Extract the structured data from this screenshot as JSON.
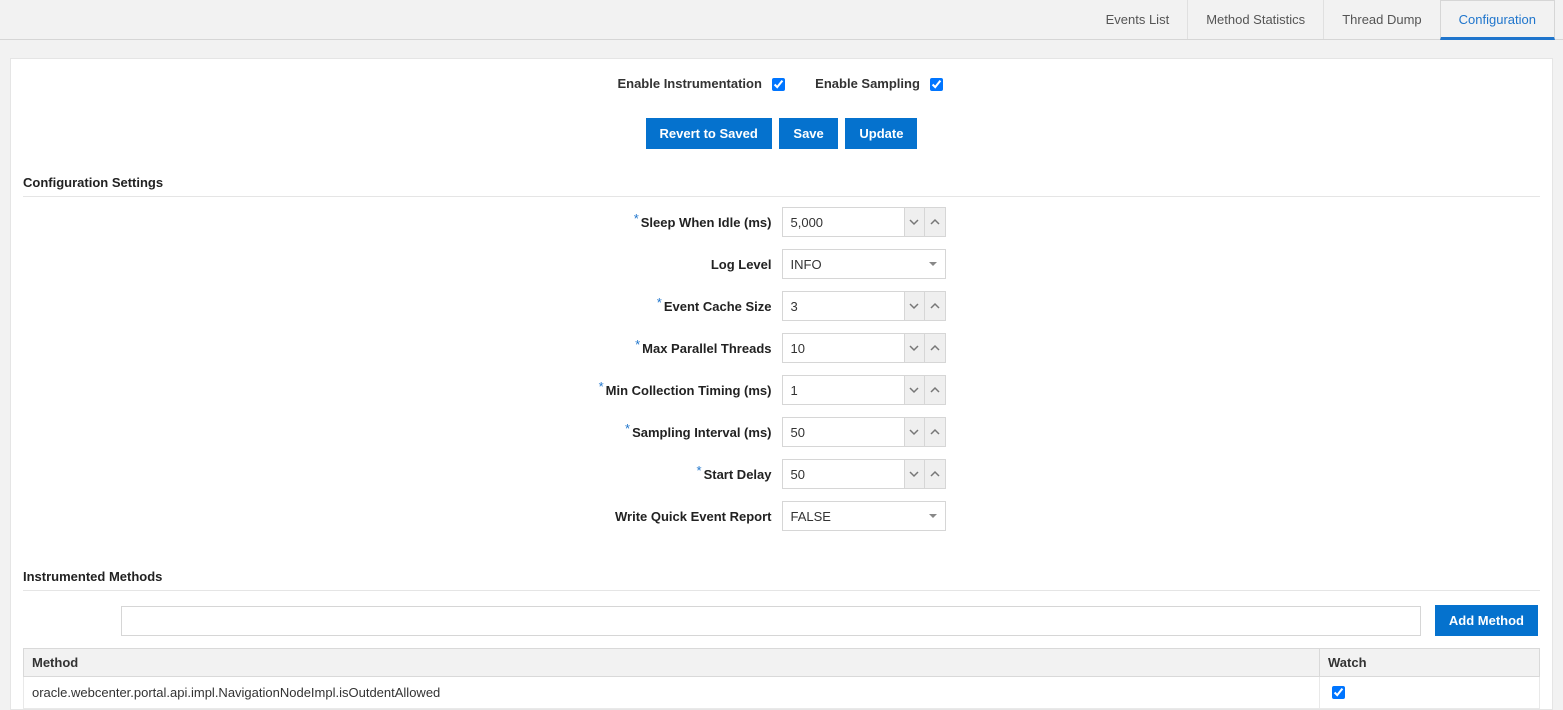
{
  "tabs": {
    "events_list": "Events List",
    "method_stats": "Method Statistics",
    "thread_dump": "Thread Dump",
    "configuration": "Configuration"
  },
  "toggles": {
    "enable_instrumentation_label": "Enable Instrumentation",
    "enable_sampling_label": "Enable Sampling",
    "enable_instrumentation_checked": true,
    "enable_sampling_checked": true
  },
  "buttons": {
    "revert": "Revert to Saved",
    "save": "Save",
    "update": "Update"
  },
  "section_config_settings": "Configuration Settings",
  "fields": {
    "sleep_when_idle": {
      "label": "Sleep When Idle (ms)",
      "value": "5,000",
      "required": true
    },
    "log_level": {
      "label": "Log Level",
      "value": "INFO",
      "required": false
    },
    "event_cache_size": {
      "label": "Event Cache Size",
      "value": "3",
      "required": true
    },
    "max_parallel_threads": {
      "label": "Max Parallel Threads",
      "value": "10",
      "required": true
    },
    "min_collection_timing": {
      "label": "Min Collection Timing (ms)",
      "value": "1",
      "required": true
    },
    "sampling_interval": {
      "label": "Sampling Interval (ms)",
      "value": "50",
      "required": true
    },
    "start_delay": {
      "label": "Start Delay",
      "value": "50",
      "required": true
    },
    "write_quick_event_report": {
      "label": "Write Quick Event Report",
      "value": "FALSE",
      "required": false
    }
  },
  "section_instrumented_methods": "Instrumented Methods",
  "add_method": {
    "input_value": "",
    "button_label": "Add Method"
  },
  "methods_table": {
    "headers": {
      "method": "Method",
      "watch": "Watch"
    },
    "rows": [
      {
        "method": "oracle.webcenter.portal.api.impl.NavigationNodeImpl.isOutdentAllowed",
        "watch_checked": true
      }
    ]
  }
}
